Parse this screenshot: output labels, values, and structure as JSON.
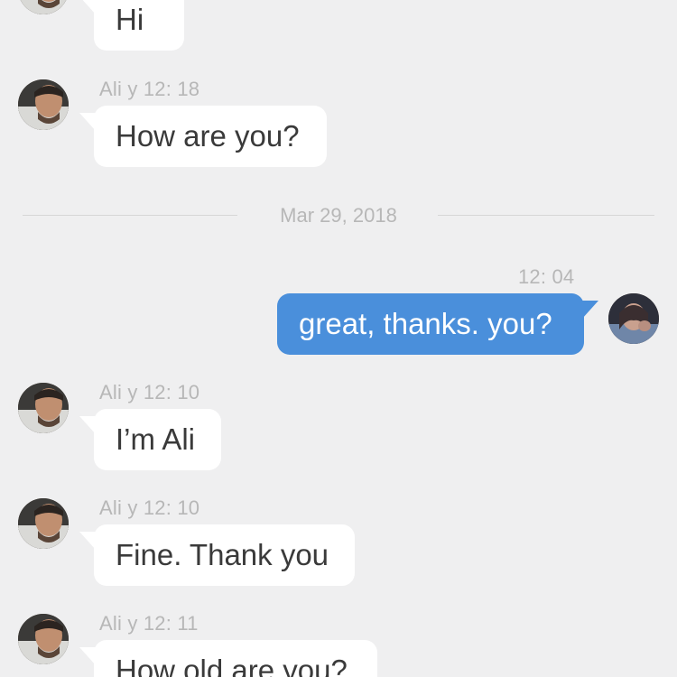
{
  "conversation": {
    "messages": [
      {
        "id": "m1",
        "direction": "incoming",
        "text": "Hi"
      },
      {
        "id": "m2",
        "direction": "incoming",
        "meta": "Ali y 12: 18",
        "text": "How are you?"
      },
      {
        "id": "m3",
        "direction": "outgoing",
        "meta": "12: 04",
        "text": "great, thanks. you?"
      },
      {
        "id": "m4",
        "direction": "incoming",
        "meta": "Ali y 12: 10",
        "text": "I’m Ali"
      },
      {
        "id": "m5",
        "direction": "incoming",
        "meta": "Ali y 12: 10",
        "text": "Fine. Thank you"
      },
      {
        "id": "m6",
        "direction": "incoming",
        "meta": "Ali y 12: 11",
        "text": "How old are you?"
      }
    ],
    "date_separator": "Mar 29, 2018"
  },
  "colors": {
    "background": "#efeff0",
    "incoming_bubble": "#ffffff",
    "outgoing_bubble": "#4a8fdb",
    "meta_text": "#b7b7b7"
  },
  "icons": {
    "contact_avatar": "person-avatar-icon",
    "self_avatar": "person-avatar-icon"
  }
}
